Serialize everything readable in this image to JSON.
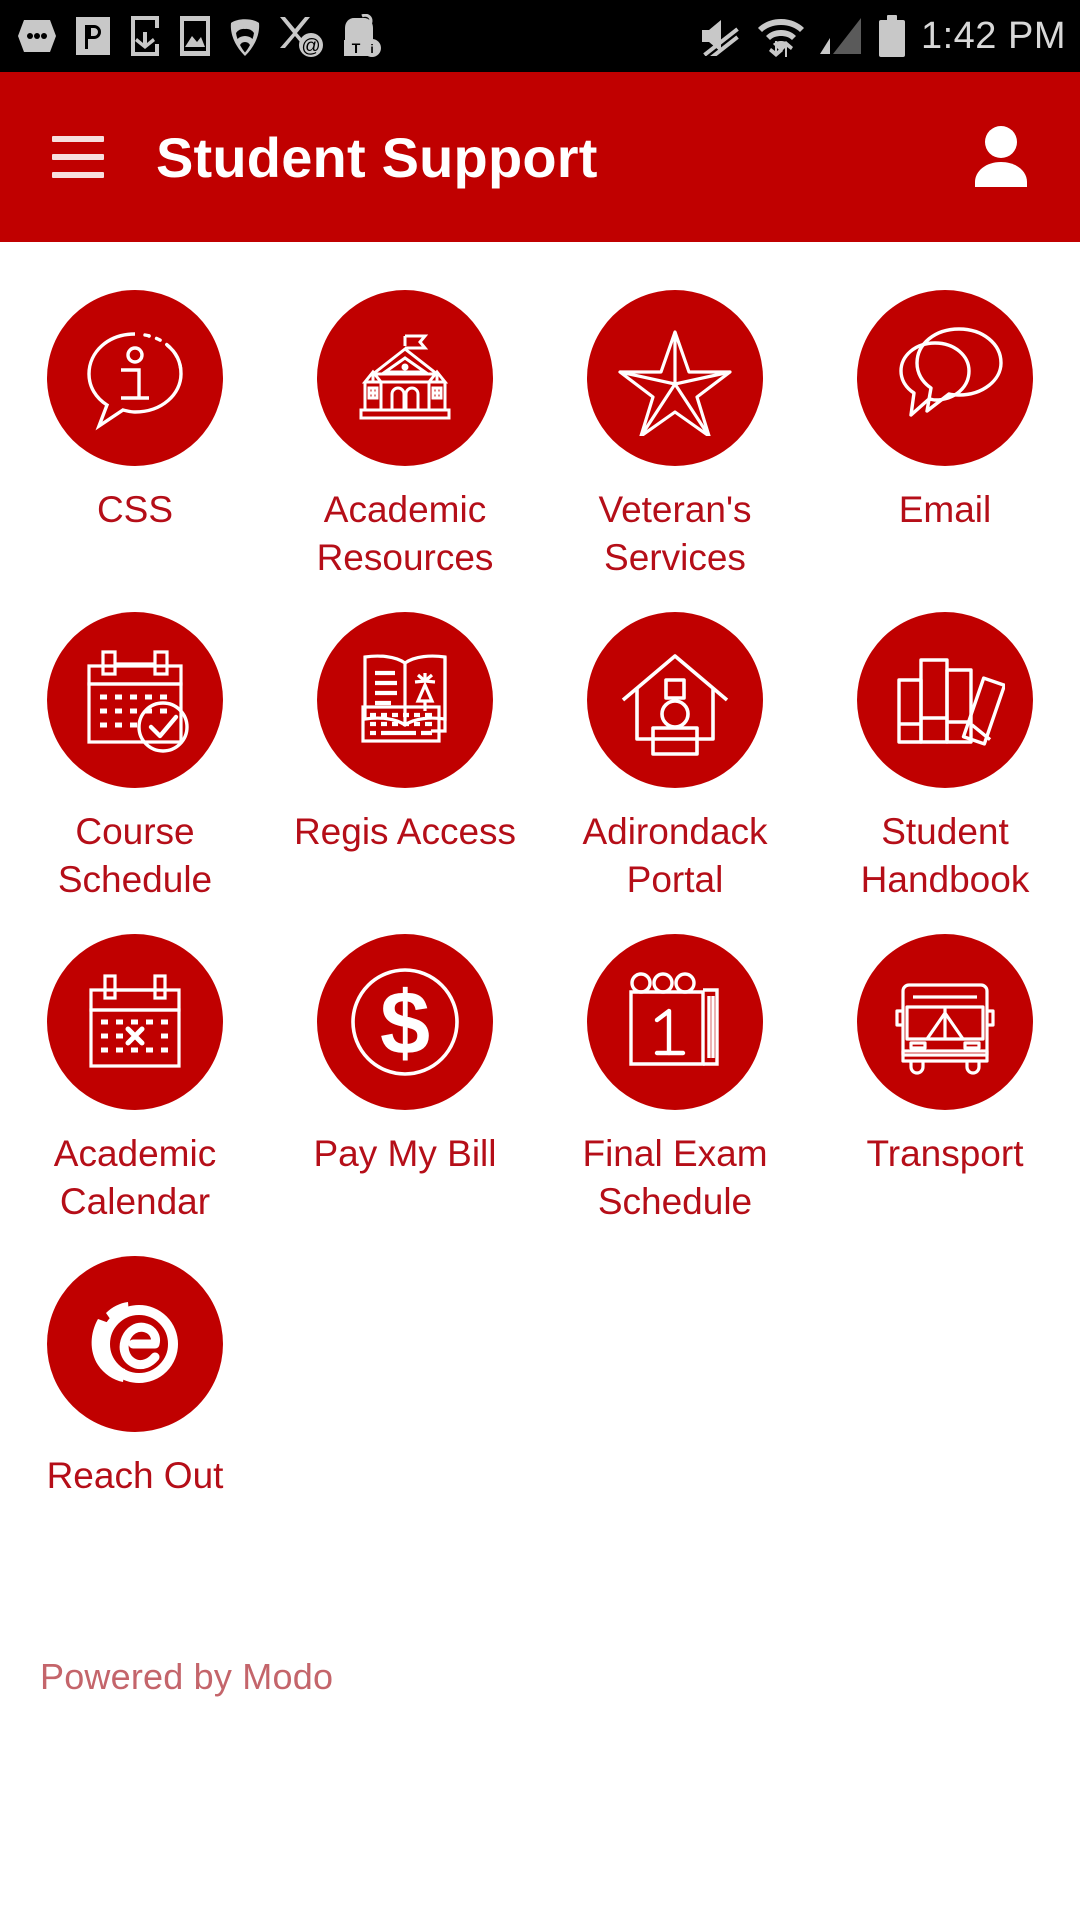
{
  "status_bar": {
    "time": "1:42 PM",
    "icons_left": [
      "messages-icon",
      "app-p-icon",
      "download-to-phone-icon",
      "photo-icon",
      "signal-cone-icon",
      "mail-at-icon",
      "t-info-tag-icon"
    ],
    "icons_right": [
      "mute-icon",
      "wifi-data-transfer-icon",
      "cellular-signal-icon",
      "battery-icon"
    ]
  },
  "app_bar": {
    "menu_label": "Menu",
    "title": "Student Support",
    "profile_label": "Profile"
  },
  "colors": {
    "brand_red": "#C00000",
    "label_red": "#B50E18",
    "footer_red": "#C4656B",
    "status_bar_bg": "#000000",
    "page_bg": "#FFFFFF"
  },
  "grid": {
    "tiles": [
      {
        "label": "CSS",
        "icon": "info-speech-bubble-icon"
      },
      {
        "label": "Academic Resources",
        "icon": "campus-building-icon"
      },
      {
        "label": "Veteran's Services",
        "icon": "star-icon"
      },
      {
        "label": "Email",
        "icon": "chat-bubbles-icon"
      },
      {
        "label": "Course Schedule",
        "icon": "calendar-check-icon"
      },
      {
        "label": "Regis Access",
        "icon": "book-keyboard-icon"
      },
      {
        "label": "Adirondack Portal",
        "icon": "house-person-icon"
      },
      {
        "label": "Student Handbook",
        "icon": "books-icon"
      },
      {
        "label": "Academic Calendar",
        "icon": "calendar-x-icon"
      },
      {
        "label": "Pay My Bill",
        "icon": "dollar-circle-icon"
      },
      {
        "label": "Final Exam Schedule",
        "icon": "tearoff-calendar-one-icon"
      },
      {
        "label": "Transport",
        "icon": "bus-icon"
      },
      {
        "label": "Reach Out",
        "icon": "reach-out-e-icon"
      }
    ]
  },
  "footer": {
    "powered_by": "Powered by Modo"
  }
}
